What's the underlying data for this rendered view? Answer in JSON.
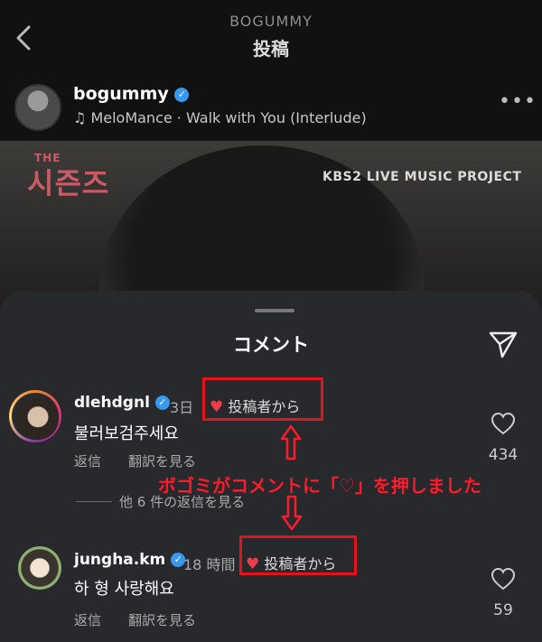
{
  "header": {
    "account": "BOGUMMY",
    "title": "投稿"
  },
  "post": {
    "username": "bogummy",
    "music": "MeloMance · Walk with You (Interlude)",
    "more": "•••",
    "image": {
      "logo_small": "THE",
      "logo": "시즌즈",
      "tag": "KBS2 LIVE MUSIC PROJECT"
    }
  },
  "sheet": {
    "title": "コメント"
  },
  "comments": [
    {
      "username": "dlehdgnl",
      "time": "3日",
      "liked_label": "投稿者から",
      "text": "불러보검주세요",
      "reply": "返信",
      "translate": "翻訳を見る",
      "likes": "434"
    },
    {
      "username": "jungha.km",
      "time": "18 時間",
      "liked_label": "投稿者から",
      "text": "하 형 사랑해요",
      "reply": "返信",
      "translate": "翻訳を見る",
      "likes": "59"
    }
  ],
  "view_replies": "他 6 件の返信を見る",
  "annotation": "ボゴミがコメントに「♡」を押しました",
  "colors": {
    "highlight": "#e3141b",
    "heart": "#ed3c4e",
    "verified": "#3897f0"
  }
}
